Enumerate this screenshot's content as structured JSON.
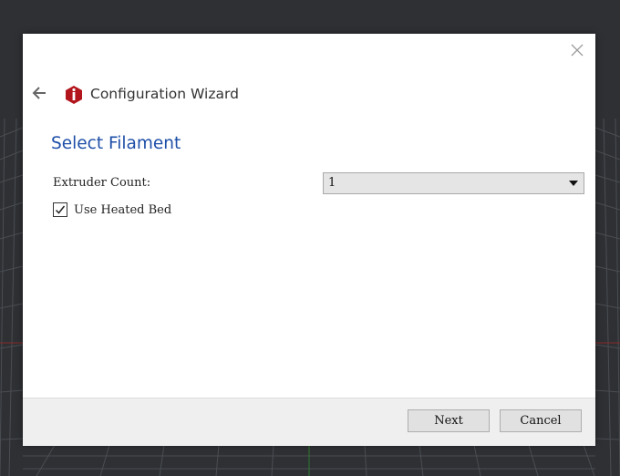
{
  "theme": {
    "accent": "#1e4fa8",
    "logo_red": "#b3151c",
    "backdrop": "#2e3034",
    "grid_line": "#4a4d52"
  },
  "header": {
    "title": "Configuration Wizard",
    "back_icon": "arrow-left-icon",
    "close_icon": "close-icon",
    "logo_icon": "app-logo-icon"
  },
  "page": {
    "heading": "Select Filament",
    "extruder_count_label": "Extruder Count:",
    "extruder_count_value": "1",
    "heated_bed_label": "Use Heated Bed",
    "heated_bed_checked": true
  },
  "footer": {
    "next_label": "Next",
    "cancel_label": "Cancel"
  }
}
